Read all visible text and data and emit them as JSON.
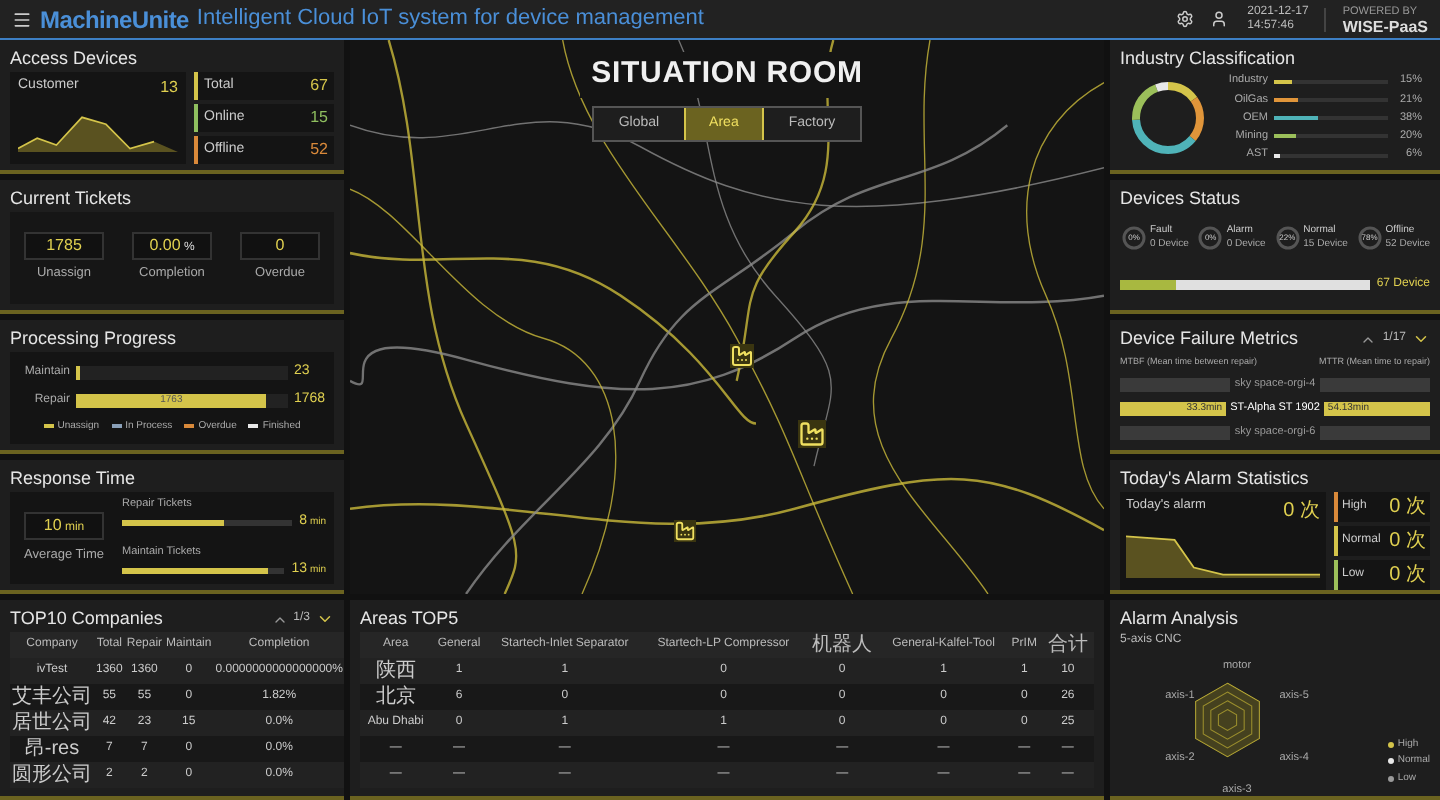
{
  "header": {
    "brand": "MachineUnite",
    "title": "Intelligent Cloud IoT system for device management",
    "date": "2021-12-17",
    "time": "14:57:46",
    "powered_by": "POWERED BY",
    "platform": "WISE-PaaS"
  },
  "access_devices": {
    "title": "Access Devices",
    "customer_label": "Customer",
    "customer_value": "13",
    "stats": [
      {
        "label": "Total",
        "value": "67",
        "color": "#d4c44a"
      },
      {
        "label": "Online",
        "value": "15",
        "color": "#8fbf5f"
      },
      {
        "label": "Offline",
        "value": "52",
        "color": "#d9893a"
      }
    ]
  },
  "current_tickets": {
    "title": "Current Tickets",
    "items": [
      {
        "value": "1785",
        "label": "Unassign"
      },
      {
        "value": "0.00",
        "unit": "%",
        "label": "Completion"
      },
      {
        "value": "0",
        "label": "Overdue"
      }
    ]
  },
  "processing_progress": {
    "title": "Processing Progress",
    "bars": [
      {
        "label": "Maintain",
        "level": 0.01,
        "value": "23"
      },
      {
        "label": "Repair",
        "level": 0.9,
        "inner": "1763",
        "value": "1768"
      }
    ],
    "legend": [
      {
        "label": "Unassign",
        "color": "#d4c44a"
      },
      {
        "label": "In Process",
        "color": "#8aa0b8"
      },
      {
        "label": "Overdue",
        "color": "#d9893a"
      },
      {
        "label": "Finished",
        "color": "#e8e8e8"
      }
    ]
  },
  "response_time": {
    "title": "Response Time",
    "average_value": "10",
    "average_unit": "min",
    "average_label": "Average Time",
    "bars": [
      {
        "label": "Repair Tickets",
        "level": 0.6,
        "value": "8",
        "unit": "min"
      },
      {
        "label": "Maintain Tickets",
        "level": 0.9,
        "value": "13",
        "unit": "min"
      }
    ]
  },
  "situation_room": {
    "title": "SITUATION ROOM",
    "tabs": [
      {
        "label": "Global",
        "selected": false
      },
      {
        "label": "Area",
        "selected": true
      },
      {
        "label": "Factory",
        "selected": false
      }
    ]
  },
  "industry_classification": {
    "title": "Industry Classification",
    "items": [
      {
        "label": "Industry",
        "level": 0.15,
        "percent": "15%",
        "color": "#d4c44a"
      },
      {
        "label": "OilGas",
        "level": 0.21,
        "percent": "21%",
        "color": "#e0953a"
      },
      {
        "label": "OEM",
        "level": 0.38,
        "percent": "38%",
        "color": "#4fb3b8"
      },
      {
        "label": "Mining",
        "level": 0.2,
        "percent": "20%",
        "color": "#9bbf5a"
      },
      {
        "label": "AST",
        "level": 0.06,
        "percent": "6%",
        "color": "#e8e8e8"
      }
    ]
  },
  "devices_status": {
    "title": "Devices Status",
    "items": [
      {
        "label": "Fault",
        "percent": "0%",
        "count": "0 Device"
      },
      {
        "label": "Alarm",
        "percent": "0%",
        "count": "0 Device"
      },
      {
        "label": "Normal",
        "percent": "22%",
        "count": "15 Device"
      },
      {
        "label": "Offline",
        "percent": "78%",
        "count": "52 Device"
      }
    ],
    "level": 0.22,
    "total": "67 Device"
  },
  "device_failure_metrics": {
    "title": "Device Failure Metrics",
    "pager": "1/17",
    "mtbf_label": "MTBF (Mean time between repair)",
    "mttr_label": "MTTR (Mean time to repair)",
    "rows": [
      {
        "name": "sky space-orgi-4",
        "selected": false
      },
      {
        "name": "ST-Alpha ST 1902",
        "mtbf": "33.3min",
        "mttr": "54.13min",
        "selected": true
      },
      {
        "name": "sky space-orgi-6",
        "selected": false
      }
    ]
  },
  "todays_alarm": {
    "title": "Today's Alarm Statistics",
    "today_label": "Today's alarm",
    "today_value": "0",
    "today_unit": "次",
    "levels": [
      {
        "label": "High",
        "value": "0",
        "unit": "次",
        "color": "#d9893a"
      },
      {
        "label": "Normal",
        "value": "0",
        "unit": "次",
        "color": "#d4c44a"
      },
      {
        "label": "Low",
        "value": "0",
        "unit": "次",
        "color": "#9bbf5a"
      }
    ]
  },
  "top10_companies": {
    "title": "TOP10 Companies",
    "pager": "1/3",
    "columns": [
      "Company",
      "Total",
      "Repair",
      "Maintain",
      "Completion"
    ],
    "rows": [
      [
        "ivTest",
        "1360",
        "1360",
        "0",
        "0.0000000000000000%"
      ],
      [
        "艾丰公司",
        "55",
        "55",
        "0",
        "1.82%"
      ],
      [
        "居世公司",
        "42",
        "23",
        "15",
        "0.0%"
      ],
      [
        "昂-res",
        "7",
        "7",
        "0",
        "0.0%"
      ],
      [
        "圆形公司",
        "2",
        "2",
        "0",
        "0.0%"
      ]
    ]
  },
  "areas_top5": {
    "title": "Areas TOP5",
    "columns": [
      "Area",
      "General",
      "Startech-Inlet Separator",
      "Startech-LP Compressor",
      "机器人",
      "General-Kalfel-Tool",
      "PrIM",
      "合计"
    ],
    "rows": [
      [
        "陕西",
        "1",
        "1",
        "0",
        "0",
        "1",
        "1",
        "10"
      ],
      [
        "北京",
        "6",
        "0",
        "0",
        "0",
        "0",
        "0",
        "26"
      ],
      [
        "Abu Dhabi",
        "0",
        "1",
        "1",
        "0",
        "0",
        "0",
        "25"
      ],
      [
        "—",
        "—",
        "—",
        "—",
        "—",
        "—",
        "—",
        "—"
      ],
      [
        "—",
        "—",
        "—",
        "—",
        "—",
        "—",
        "—",
        "—"
      ]
    ]
  },
  "alarm_analysis": {
    "title": "Alarm Analysis",
    "device": "5-axis CNC",
    "axes": [
      "motor",
      "axis-5",
      "axis-4",
      "axis-3",
      "axis-2",
      "axis-1"
    ],
    "legend": [
      {
        "label": "High",
        "color": "#d4c44a"
      },
      {
        "label": "Normal",
        "color": "#e8e8e8"
      },
      {
        "label": "Low",
        "color": "#9a9a9a"
      }
    ]
  }
}
